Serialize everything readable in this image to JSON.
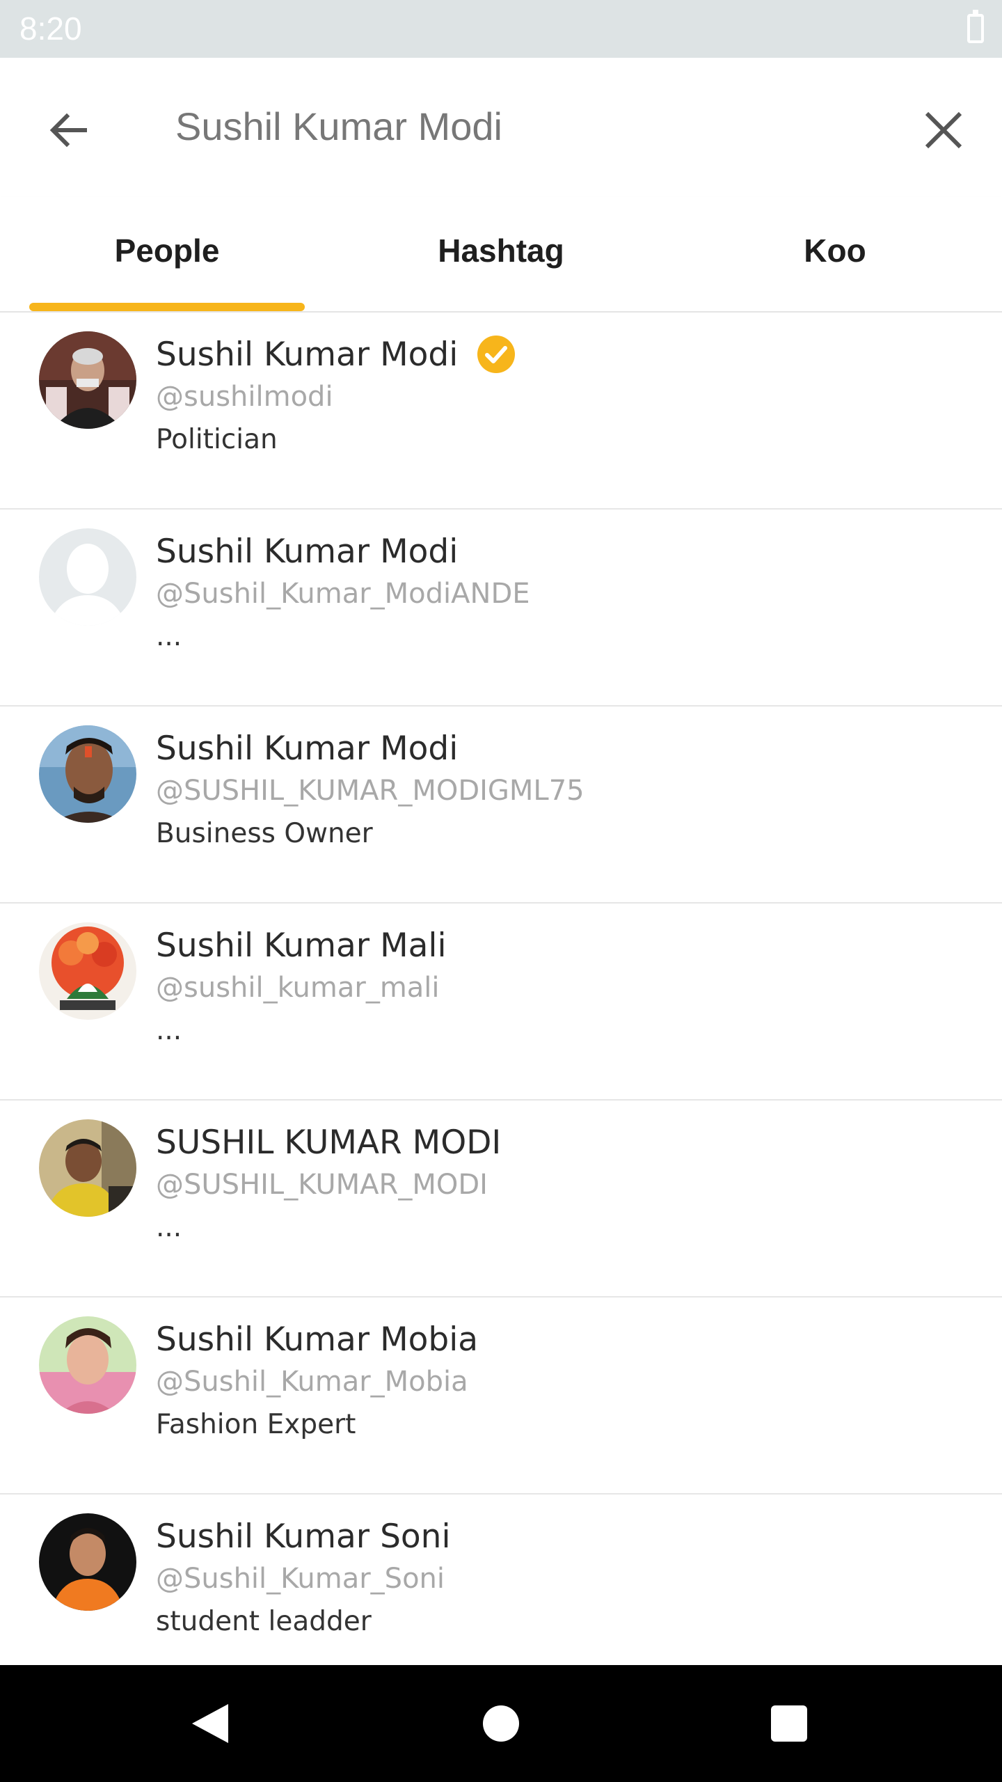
{
  "status_bar": {
    "time": "8:20",
    "icons": [
      "battery-icon"
    ]
  },
  "search": {
    "query": "Sushil Kumar Modi",
    "back_icon": "arrow-left-icon",
    "clear_icon": "close-icon"
  },
  "tabs": [
    {
      "label": "People",
      "selected": true
    },
    {
      "label": "Hashtag",
      "selected": false
    },
    {
      "label": "Koo",
      "selected": false
    }
  ],
  "accent_color": "#f7b51b",
  "results": [
    {
      "name": "Sushil Kumar Modi",
      "handle": "@sushilmodi",
      "bio": "Politician",
      "verified": true
    },
    {
      "name": "Sushil Kumar Modi",
      "handle": "@Sushil_Kumar_ModiANDE",
      "bio": "...",
      "verified": false
    },
    {
      "name": "Sushil Kumar Modi",
      "handle": "@SUSHIL_KUMAR_MODIGML75",
      "bio": "Business Owner",
      "verified": false
    },
    {
      "name": "Sushil Kumar Mali",
      "handle": "@sushil_kumar_mali",
      "bio": "...",
      "verified": false
    },
    {
      "name": "SUSHIL KUMAR MODI",
      "handle": "@SUSHIL_KUMAR_MODI",
      "bio": "...",
      "verified": false
    },
    {
      "name": "Sushil Kumar Mobia",
      "handle": "@Sushil_Kumar_Mobia",
      "bio": "Fashion Expert",
      "verified": false
    },
    {
      "name": "Sushil Kumar Soni",
      "handle": "@Sushil_Kumar_Soni",
      "bio": "student leadder",
      "verified": false
    }
  ],
  "nav_bar": {
    "icons": [
      "nav-back-icon",
      "nav-home-icon",
      "nav-recents-icon"
    ]
  }
}
